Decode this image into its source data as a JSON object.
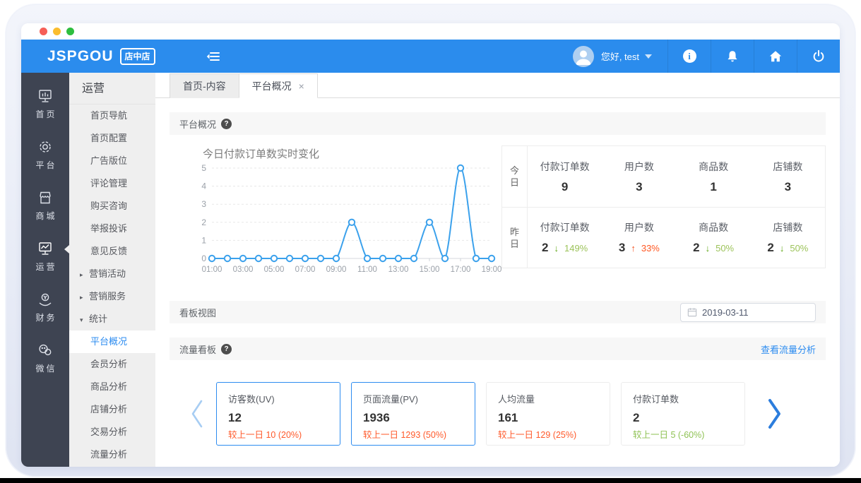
{
  "topbar": {
    "brand": "JSPGOU",
    "brand_badge": "店中店",
    "greeting": "您好, test"
  },
  "sidebar": {
    "primary": [
      {
        "label": "首页",
        "icon": "dashboard-monitor-icon",
        "active": false
      },
      {
        "label": "平台",
        "icon": "gear-icon",
        "active": false
      },
      {
        "label": "商城",
        "icon": "store-icon",
        "active": false
      },
      {
        "label": "运营",
        "icon": "monitor-chart-icon",
        "active": true
      },
      {
        "label": "财务",
        "icon": "finance-coin-hand-icon",
        "active": false
      },
      {
        "label": "微信",
        "icon": "wechat-icon",
        "active": false
      }
    ],
    "secondary": {
      "title": "运营",
      "items": [
        {
          "label": "首页导航"
        },
        {
          "label": "首页配置"
        },
        {
          "label": "广告版位"
        },
        {
          "label": "评论管理"
        },
        {
          "label": "购买咨询"
        },
        {
          "label": "举报投诉"
        },
        {
          "label": "意见反馈"
        },
        {
          "label": "营销活动",
          "expander": "collapsed"
        },
        {
          "label": "营销服务",
          "expander": "collapsed"
        },
        {
          "label": "统计",
          "expander": "expanded"
        },
        {
          "label": "平台概况",
          "active": true
        },
        {
          "label": "会员分析"
        },
        {
          "label": "商品分析"
        },
        {
          "label": "店铺分析"
        },
        {
          "label": "交易分析"
        },
        {
          "label": "流量分析"
        }
      ]
    }
  },
  "tabs": [
    {
      "label": "首页-内容",
      "active": false
    },
    {
      "label": "平台概况",
      "active": true,
      "closable": true
    }
  ],
  "platform_overview": {
    "panel_title": "平台概况",
    "chart_title": "今日付款订单数实时变化",
    "rows": [
      {
        "period": "今日",
        "stats": [
          {
            "label": "付款订单数",
            "value": "9"
          },
          {
            "label": "用户数",
            "value": "3"
          },
          {
            "label": "商品数",
            "value": "1"
          },
          {
            "label": "店铺数",
            "value": "3"
          }
        ]
      },
      {
        "period": "昨日",
        "stats": [
          {
            "label": "付款订单数",
            "value": "2",
            "change": "149%",
            "direction": "down"
          },
          {
            "label": "用户数",
            "value": "3",
            "change": "33%",
            "direction": "up"
          },
          {
            "label": "商品数",
            "value": "2",
            "change": "50%",
            "direction": "down"
          },
          {
            "label": "店铺数",
            "value": "2",
            "change": "50%",
            "direction": "down"
          }
        ]
      }
    ]
  },
  "dashboard_view": {
    "title": "看板视图",
    "date": "2019-03-11"
  },
  "traffic_board": {
    "title": "流量看板",
    "link": "查看流量分析",
    "cards": [
      {
        "title": "访客数(UV)",
        "value": "12",
        "compare": "较上一日 10 (20%)",
        "tone": "orange",
        "highlighted": true
      },
      {
        "title": "页面流量(PV)",
        "value": "1936",
        "compare": "较上一日 1293 (50%)",
        "tone": "orange",
        "highlighted": true
      },
      {
        "title": "人均流量",
        "value": "161",
        "compare": "较上一日 129 (25%)",
        "tone": "orange",
        "highlighted": false
      },
      {
        "title": "付款订单数",
        "value": "2",
        "compare": "较上一日 5 (-60%)",
        "tone": "green",
        "highlighted": false
      }
    ]
  },
  "chart_data": {
    "type": "line",
    "title": "今日付款订单数实时变化",
    "x": [
      "01:00",
      "02:00",
      "03:00",
      "04:00",
      "05:00",
      "06:00",
      "07:00",
      "08:00",
      "09:00",
      "10:00",
      "11:00",
      "12:00",
      "13:00",
      "14:00",
      "15:00",
      "16:00",
      "17:00",
      "18:00",
      "19:00"
    ],
    "values": [
      0,
      0,
      0,
      0,
      0,
      0,
      0,
      0,
      0,
      2,
      0,
      0,
      0,
      0,
      2,
      0,
      5,
      0,
      0
    ],
    "x_tick_labels": [
      "01:00",
      "03:00",
      "05:00",
      "07:00",
      "09:00",
      "11:00",
      "13:00",
      "15:00",
      "17:00",
      "19:00"
    ],
    "ylim": [
      0,
      5
    ],
    "y_ticks": [
      0,
      1,
      2,
      3,
      4,
      5
    ],
    "grid": "dashed-horizontal",
    "legend": "none",
    "xlabel": "",
    "ylabel": ""
  },
  "icons": {
    "expander_collapsed": "▸",
    "expander_expanded": "▾",
    "close_tab": "×",
    "arrow_up": "↑",
    "arrow_down": "↓",
    "help_badge": "?",
    "info_glyph": "i"
  },
  "colors": {
    "accent_blue": "#2d8cf0",
    "topbar_blue": "#2b8ced",
    "sidebar_dark": "#3e4452",
    "chart_line": "#3ba1ec",
    "up_orange": "#ff5722",
    "down_green": "#9cc35a",
    "card_orange": "#ff5a2b",
    "card_green": "#8fc254"
  }
}
